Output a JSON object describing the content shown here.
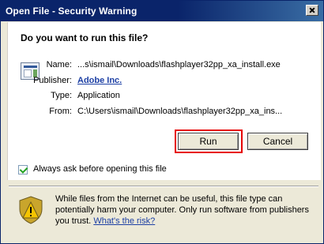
{
  "window": {
    "title": "Open File - Security Warning"
  },
  "dialog": {
    "headline": "Do you want to run this file?",
    "fields": {
      "name_label": "Name:",
      "name_value": "...s\\ismail\\Downloads\\flashplayer32pp_xa_install.exe",
      "publisher_label": "Publisher:",
      "publisher_value": "Adobe Inc.",
      "type_label": "Type:",
      "type_value": "Application",
      "from_label": "From:",
      "from_value": "C:\\Users\\ismail\\Downloads\\flashplayer32pp_xa_ins..."
    },
    "buttons": {
      "run": "Run",
      "cancel": "Cancel"
    },
    "checkbox": {
      "label": "Always ask before opening this file",
      "checked": true
    },
    "warning": {
      "line1": "While files from the Internet can be useful, this file type can",
      "line2": "potentially harm your computer. Only run software from publishers",
      "line3_prefix": "you trust.",
      "risk_link": "What's the risk?"
    }
  },
  "icons": {
    "file": "file-icon",
    "warning": "shield-warning-icon",
    "close": "close-icon"
  },
  "colors": {
    "title_bar": "#0a246a",
    "highlight_outline": "#e60000",
    "link": "#1c3fa4"
  }
}
